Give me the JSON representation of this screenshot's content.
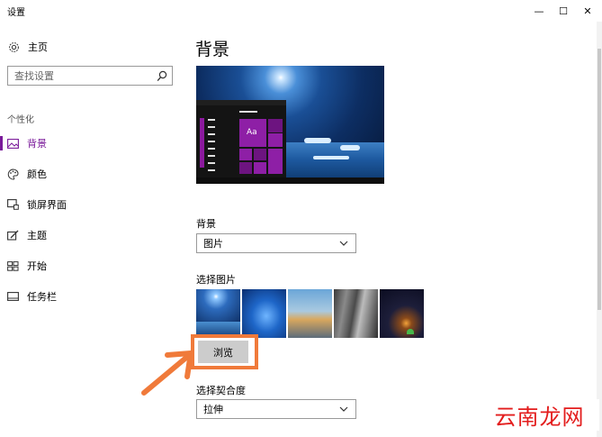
{
  "window": {
    "title": "设置",
    "minimize_glyph": "—",
    "maximize_glyph": "☐",
    "close_glyph": "✕"
  },
  "sidebar": {
    "home": {
      "label": "主页",
      "icon": "gear-icon"
    },
    "search": {
      "placeholder": "查找设置",
      "icon": "search-icon"
    },
    "section_label": "个性化",
    "items": [
      {
        "label": "背景",
        "icon": "picture-icon",
        "active": true
      },
      {
        "label": "颜色",
        "icon": "palette-icon",
        "active": false
      },
      {
        "label": "锁屏界面",
        "icon": "lock-screen-icon",
        "active": false
      },
      {
        "label": "主题",
        "icon": "theme-icon",
        "active": false
      },
      {
        "label": "开始",
        "icon": "start-grid-icon",
        "active": false
      },
      {
        "label": "任务栏",
        "icon": "taskbar-icon",
        "active": false
      }
    ],
    "accent_color": "#7a1a9a"
  },
  "main": {
    "title": "背景",
    "preview": {
      "tile_text": "Aa",
      "accent_color": "#8e1fa6"
    },
    "background_label": "背景",
    "background_value": "图片",
    "choose_picture_label": "选择图片",
    "browse_label": "浏览",
    "fit_label": "选择契合度",
    "fit_value": "拉伸"
  },
  "annotation": {
    "highlight_color": "#f07a3a"
  },
  "watermark": {
    "text": "云南龙网",
    "color": "#e31d1d"
  }
}
